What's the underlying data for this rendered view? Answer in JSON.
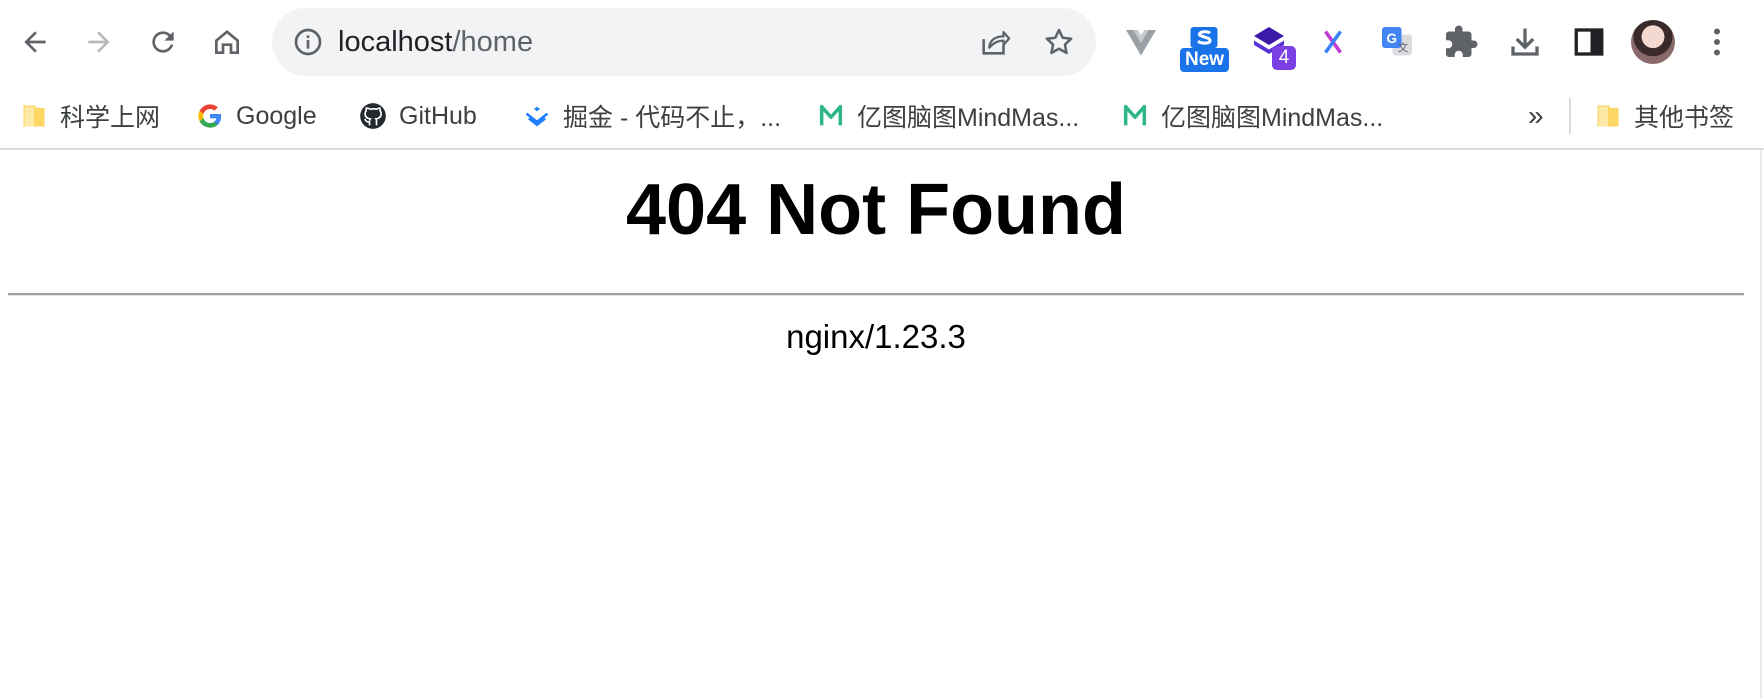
{
  "browser": {
    "url_host": "localhost",
    "url_path": "/home",
    "extensions": [
      {
        "icon": "vue-devtools-icon"
      },
      {
        "icon": "s-extension-icon",
        "badge": "New"
      },
      {
        "icon": "stack-extension-icon",
        "badge": "4"
      },
      {
        "icon": "x-extension-icon"
      },
      {
        "icon": "google-translate-icon"
      },
      {
        "icon": "puzzle-icon"
      },
      {
        "icon": "download-icon"
      },
      {
        "icon": "side-panel-icon"
      },
      {
        "icon": "profile-avatar"
      },
      {
        "icon": "kebab-menu-icon"
      }
    ]
  },
  "bookmarks": {
    "items": [
      {
        "label": "科学上网",
        "icon": "folder-icon"
      },
      {
        "label": "Google",
        "icon": "google-icon"
      },
      {
        "label": "GitHub",
        "icon": "github-icon"
      },
      {
        "label": "掘金 - 代码不止，...",
        "icon": "juejin-icon"
      },
      {
        "label": "亿图脑图MindMas...",
        "icon": "mindmaster-icon"
      },
      {
        "label": "亿图脑图MindMas...",
        "icon": "mindmaster-icon"
      }
    ],
    "overflow": "»",
    "other": "其他书签"
  },
  "page": {
    "title": "404 Not Found",
    "server": "nginx/1.23.3"
  },
  "colors": {
    "omnibox_bg": "#f1f3f4",
    "toolbar_icon": "#5f6368",
    "page_text": "#000000",
    "rule": "#a0a0a0"
  }
}
